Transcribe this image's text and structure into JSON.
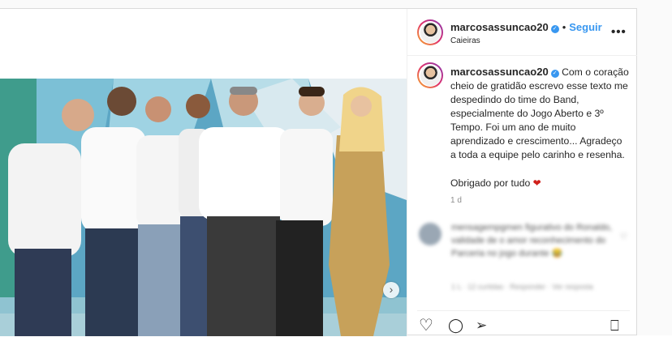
{
  "post": {
    "username": "marcosassuncao20",
    "follow_label": "Seguir",
    "separator": "•",
    "location": "Caieiras",
    "more_icon": "more-options-icon",
    "caption_text": "Com o coração cheio de gratidão escrevo esse texto me despedindo do time do Band, especialmente do Jogo Aberto e 3º Tempo. Foi um ano de muito aprendizado e crescimento... Agradeço a toda a equipe pelo carinho e resenha.",
    "thanks_text": "Obrigado por tudo",
    "heart_glyph": "❤",
    "age": "1 d",
    "next_glyph": "›"
  },
  "comment": {
    "text": "mensagempgmen figurativo do Ronaldo, validade de o amor reconhecimento do Parceria no jogo durante 😂",
    "meta": "1 L · 12 curtidas · Responder · Ver resposta",
    "like_glyph": "♡"
  },
  "actions": {
    "like_icon": "heart-outline-icon",
    "comment_icon": "comment-icon",
    "share_icon": "share-icon",
    "save_icon": "bookmark-icon",
    "like_glyph": "♡",
    "comment_glyph": "◯",
    "share_glyph": "➢",
    "save_glyph": "⎕"
  },
  "colors": {
    "link_blue": "#3897f0",
    "verified_blue": "#3897f0",
    "text": "#262626",
    "muted": "#8e8e8e",
    "heart_red": "#d0201b"
  }
}
